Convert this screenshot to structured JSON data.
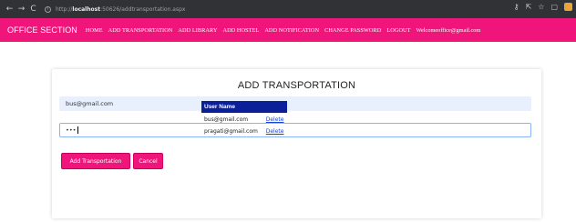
{
  "browser": {
    "back_icon": "←",
    "forward_icon": "→",
    "reload_icon": "C",
    "url_prefix": "http://",
    "url_host": "localhost",
    "url_rest": ":50626/addtransportation.aspx",
    "right_icons": [
      "key-icon",
      "share-icon",
      "star-icon",
      "window-icon",
      "extension-icon"
    ]
  },
  "nav": {
    "brand": "OFFICE SECTION",
    "links": [
      "HOME",
      "ADD TRANSPORTATION",
      "ADD LIBRARY",
      "ADD HOSTEL",
      "ADD NOTIFICATION",
      "CHANGE PASSWORD",
      "LOGOUT"
    ],
    "welcome": "Welcomeoffice@gmail.com",
    "color": "#f0157a"
  },
  "form": {
    "title": "ADD TRANSPORTATION",
    "email_value": "bus@gmail.com",
    "password_mask": "•••",
    "add_button": "Add Transportation",
    "cancel_button": "Cancel"
  },
  "table": {
    "header": "User Name",
    "header_color": "#0b1f99",
    "rows": [
      {
        "user": "bus@gmail.com",
        "action": "Delete"
      },
      {
        "user": "pragati@gmail.com",
        "action": "Delete"
      }
    ]
  }
}
